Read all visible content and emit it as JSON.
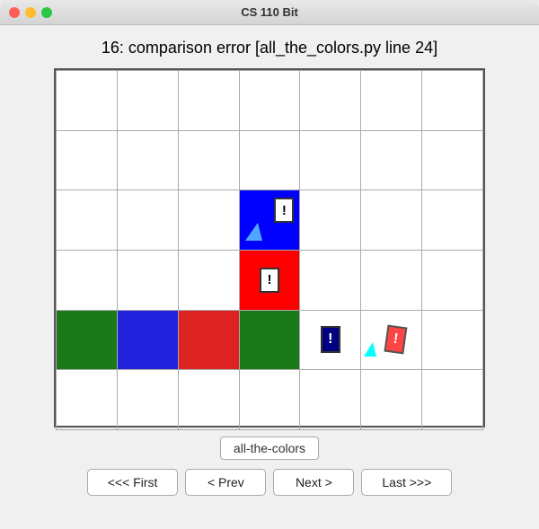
{
  "titleBar": {
    "title": "CS 110 Bit"
  },
  "header": {
    "errorText": "16: comparison error  [all_the_colors.py line 24]"
  },
  "grid": {
    "rows": 6,
    "cols": 7
  },
  "filename": {
    "label": "all-the-colors"
  },
  "nav": {
    "first": "<<< First",
    "prev": "< Prev",
    "next": "Next >",
    "last": "Last >>>"
  }
}
